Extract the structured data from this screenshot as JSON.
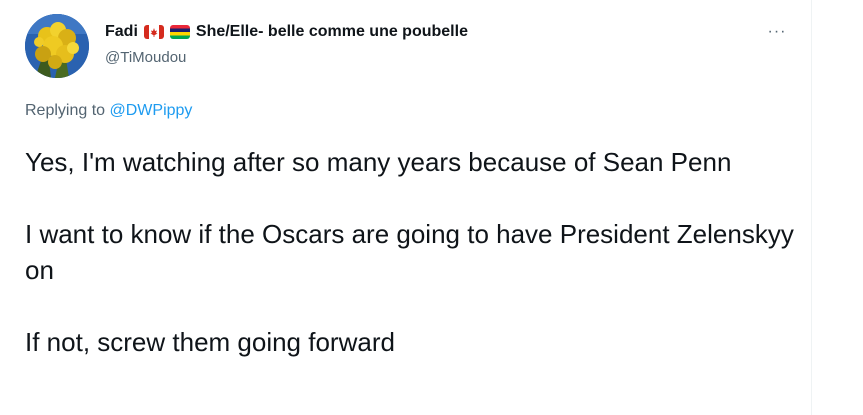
{
  "author": {
    "display_name": "Fadi",
    "flags": [
      "canada-flag",
      "mauritius-flag"
    ],
    "bio_suffix": "She/Elle- belle comme une poubelle",
    "handle": "@TiMoudou",
    "avatar_icon": "yellow-flowers-avatar"
  },
  "menu": {
    "more_icon": "more-dots-icon",
    "more_glyph": "···"
  },
  "reply": {
    "prefix": "Replying to",
    "mention": "@DWPippy"
  },
  "body": {
    "paragraphs": [
      "Yes, I'm watching after so many years because of Sean Penn",
      "I want to know if the Oscars are going to have President Zelenskyy on",
      "If not, screw them going forward"
    ]
  },
  "colors": {
    "text_primary": "#0f1419",
    "text_secondary": "#536471",
    "link": "#1d9bf0",
    "divider": "#eff3f4"
  }
}
